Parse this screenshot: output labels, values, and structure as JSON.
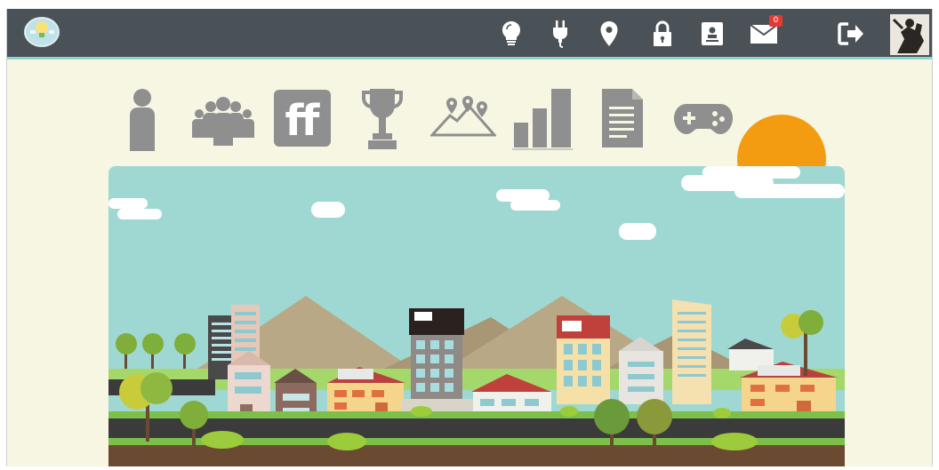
{
  "header": {
    "logo": "lightbulb-logo",
    "icons": [
      {
        "name": "lightbulb-icon"
      },
      {
        "name": "plug-icon"
      },
      {
        "name": "map-pin-icon"
      },
      {
        "name": "lock-icon"
      },
      {
        "name": "contact-card-icon"
      },
      {
        "name": "mail-icon",
        "badge": "0"
      },
      {
        "name": "logout-icon"
      }
    ],
    "avatar": "user-avatar"
  },
  "nav": {
    "items": [
      {
        "name": "person-icon"
      },
      {
        "name": "group-icon"
      },
      {
        "name": "ff-icon",
        "text": "ff"
      },
      {
        "name": "trophy-icon"
      },
      {
        "name": "map-route-icon"
      },
      {
        "name": "bar-chart-icon"
      },
      {
        "name": "document-icon"
      },
      {
        "name": "gamepad-icon"
      }
    ]
  },
  "colors": {
    "topbar": "#4a5157",
    "accent_line": "#8dd6d0",
    "background": "#f7f6e3",
    "icon_gray": "#8f8f8f",
    "sky": "#9fd8d2",
    "sun": "#f39c12",
    "badge": "#e53935"
  }
}
